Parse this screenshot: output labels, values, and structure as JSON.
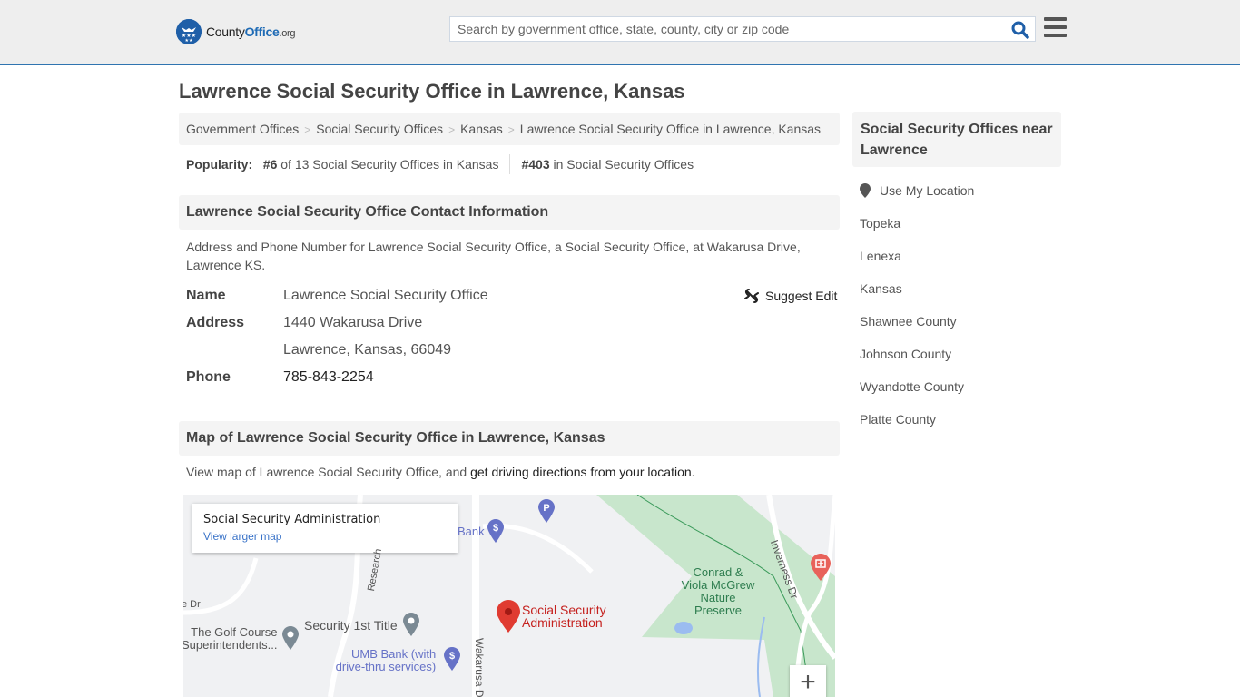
{
  "header": {
    "logo": {
      "county": "County",
      "office": "Office",
      "org": ".org"
    },
    "search_placeholder": "Search by government office, state, county, city or zip code",
    "colors": {
      "accent": "#2f74b0",
      "logo": "#1f5fa8"
    }
  },
  "page": {
    "title": "Lawrence Social Security Office in Lawrence, Kansas",
    "breadcrumb": [
      {
        "label": "Government Offices"
      },
      {
        "label": "Social Security Offices"
      },
      {
        "label": "Kansas"
      },
      {
        "label": "Lawrence Social Security Office in Lawrence, Kansas"
      }
    ],
    "popularity": {
      "label": "Popularity:",
      "state_rank": "#6",
      "state_text": "of 13 Social Security Offices in Kansas",
      "national_rank": "#403",
      "national_text": "in Social Security Offices"
    }
  },
  "contact": {
    "heading": "Lawrence Social Security Office Contact Information",
    "description": "Address and Phone Number for Lawrence Social Security Office, a Social Security Office, at Wakarusa Drive, Lawrence KS.",
    "suggest_edit": "Suggest Edit",
    "name_label": "Name",
    "name": "Lawrence Social Security Office",
    "address_label": "Address",
    "address_line1": "1440 Wakarusa Drive",
    "address_line2": "Lawrence, Kansas, 66049",
    "phone_label": "Phone",
    "phone": "785-843-2254"
  },
  "map_section": {
    "heading": "Map of Lawrence Social Security Office in Lawrence, Kansas",
    "desc_prefix": "View map of Lawrence Social Security Office, and ",
    "desc_link": "get driving directions from your location",
    "desc_suffix": ".",
    "card_title": "Social Security Administration",
    "card_link": "View larger map",
    "labels": {
      "ssa": "Social Security",
      "ssa2": "Administration",
      "bank": "Bank",
      "security_title": "Security 1st Title",
      "golf1": "The Golf Course",
      "golf2": "Superintendents...",
      "umb1": "UMB Bank (with",
      "umb2": "drive-thru services)",
      "preserve1": "Conrad &",
      "preserve2": "Viola McGrew",
      "preserve3": "Nature",
      "preserve4": "Preserve",
      "wakarusa": "Wakarusa Dr",
      "inverness": "Inverness Dr",
      "research": "Research",
      "dr": "e Dr",
      "parking": "P"
    },
    "zoom_in": "+"
  },
  "sidebar": {
    "heading": "Social Security Offices near Lawrence",
    "use_location": "Use My Location",
    "links": [
      "Topeka",
      "Lenexa",
      "Kansas",
      "Shawnee County",
      "Johnson County",
      "Wyandotte County",
      "Platte County"
    ]
  }
}
